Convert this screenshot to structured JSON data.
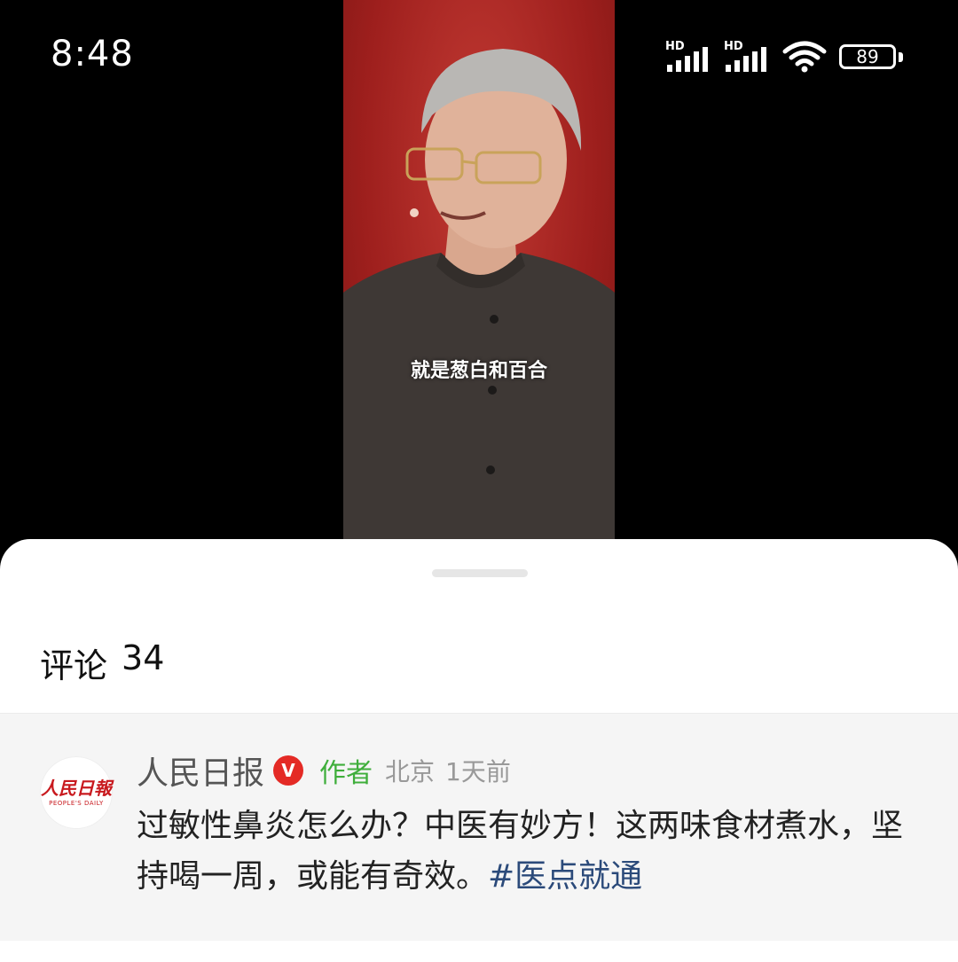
{
  "status_bar": {
    "time": "8:48",
    "signal1_label": "HD",
    "signal2_label": "HD",
    "battery_level": "89"
  },
  "video": {
    "subtitle": "就是葱白和百合"
  },
  "comments_sheet": {
    "title_label": "评论",
    "count": "34",
    "comments": [
      {
        "avatar_text": "人民日報",
        "avatar_subtext": "PEOPLE'S DAILY",
        "author": "人民日报",
        "verified_label": "V",
        "author_tag": "作者",
        "location": "北京",
        "time": "1天前",
        "text": "过敏性鼻炎怎么办？中医有妙方！这两味食材煮水，坚持喝一周，或能有奇效。",
        "hashtag": "#医点就通"
      }
    ]
  },
  "colors": {
    "video_background": "#a5221f",
    "verified_badge": "#e42a25",
    "author_tag": "#3fae3b",
    "hashtag": "#2b4a7a"
  }
}
